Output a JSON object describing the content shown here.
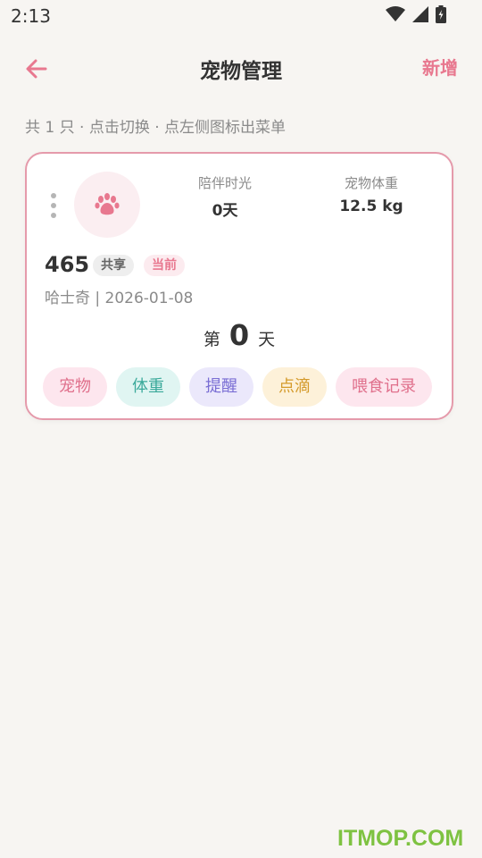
{
  "status_bar": {
    "time": "2:13"
  },
  "header": {
    "title": "宠物管理",
    "add_label": "新增"
  },
  "summary": "共 1 只 · 点击切换 · 点左侧图标出菜单",
  "pet": {
    "stat_time_label": "陪伴时光",
    "stat_time_value": "0天",
    "stat_weight_label": "宠物体重",
    "stat_weight_value": "12.5 kg",
    "name": "465",
    "badge_shared": "共享",
    "badge_current": "当前",
    "info": "哈士奇 | 2026-01-08",
    "day_prefix": "第",
    "day_number": "0",
    "day_suffix": "天"
  },
  "actions": [
    {
      "label": "宠物",
      "bg": "#fde6ee",
      "fg": "#e0708c"
    },
    {
      "label": "体重",
      "bg": "#e0f5f2",
      "fg": "#3aa99a"
    },
    {
      "label": "提醒",
      "bg": "#ebe8fb",
      "fg": "#7a6ed4"
    },
    {
      "label": "点滴",
      "bg": "#fdf1d9",
      "fg": "#d49a2a"
    },
    {
      "label": "喂食记录",
      "bg": "#fde6ee",
      "fg": "#e0708c"
    }
  ],
  "colors": {
    "accent": "#e8788f",
    "card_border": "#e59aab",
    "background": "#f7f5f2"
  },
  "watermark": "ITMOP.COM"
}
